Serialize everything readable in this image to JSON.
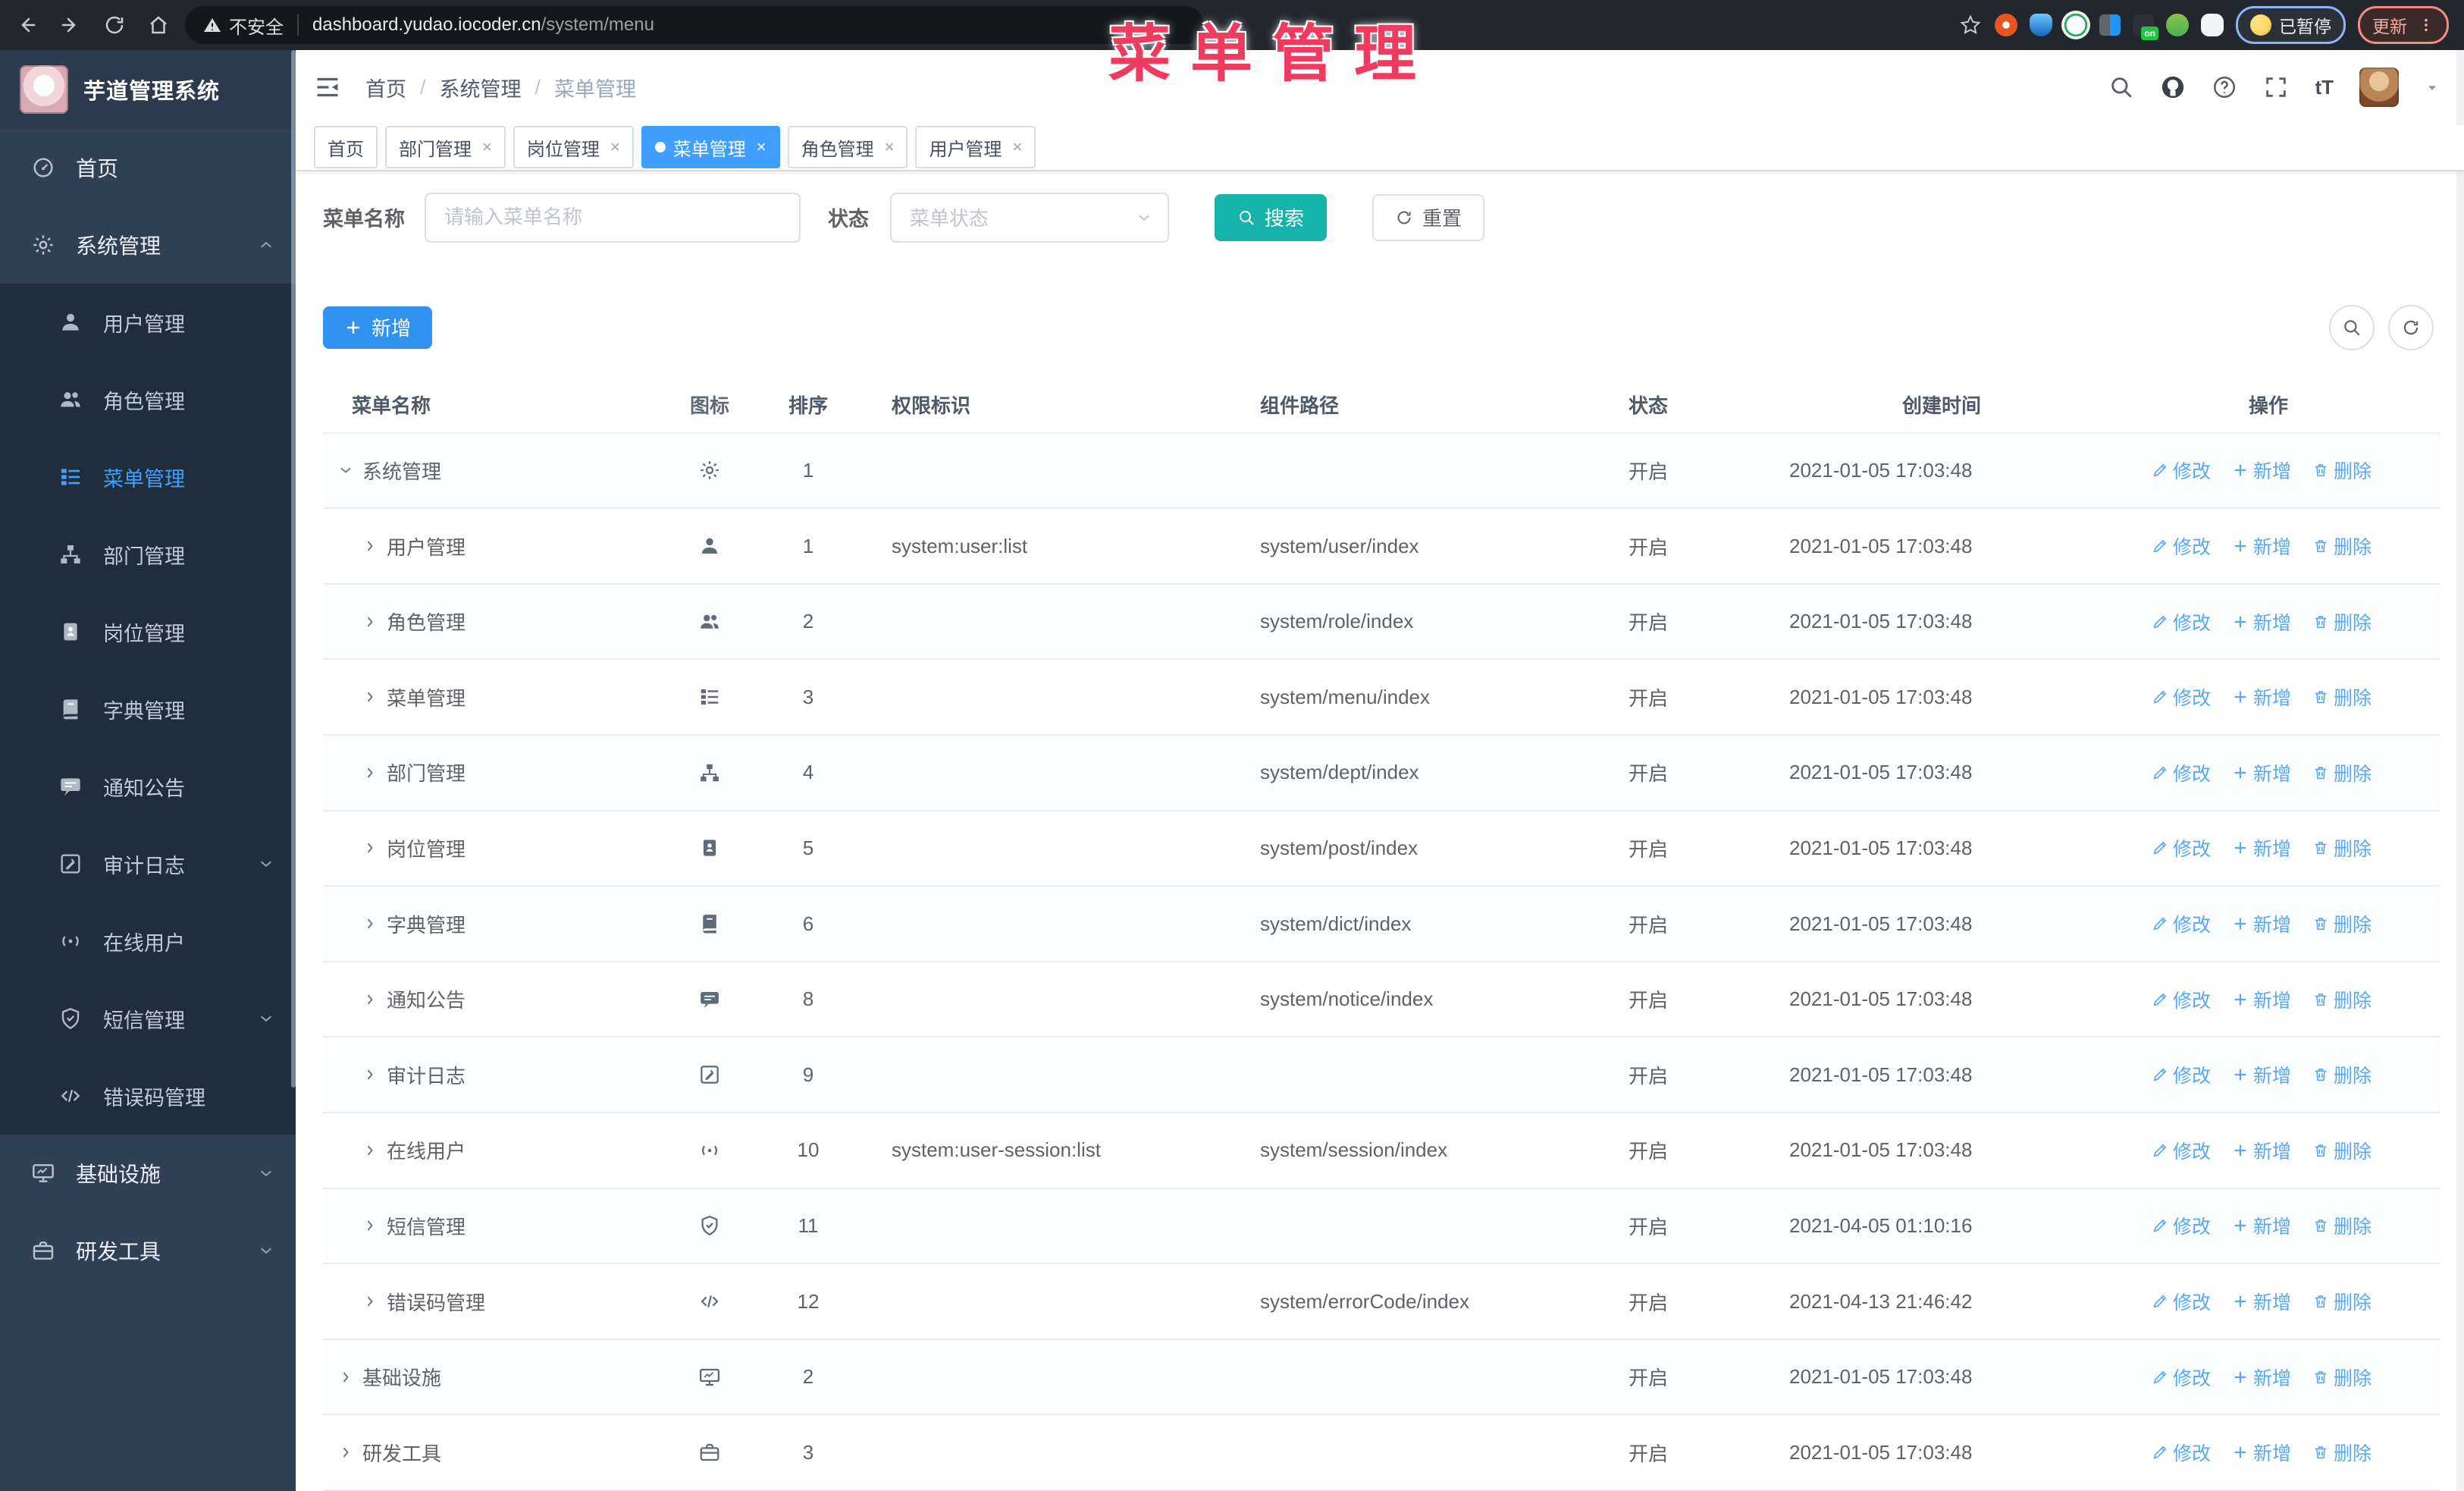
{
  "overlay_title": "菜单管理",
  "browser": {
    "security_label": "不安全",
    "url_host": "dashboard.yudao.iocoder.cn",
    "url_path": "/system/menu",
    "paused_label": "已暂停",
    "update_label": "更新"
  },
  "header": {
    "breadcrumb": [
      "首页",
      "系统管理",
      "菜单管理"
    ]
  },
  "tabs": [
    {
      "label": "首页",
      "closable": false,
      "active": false
    },
    {
      "label": "部门管理",
      "closable": true,
      "active": false
    },
    {
      "label": "岗位管理",
      "closable": true,
      "active": false
    },
    {
      "label": "菜单管理",
      "closable": true,
      "active": true
    },
    {
      "label": "角色管理",
      "closable": true,
      "active": false
    },
    {
      "label": "用户管理",
      "closable": true,
      "active": false
    }
  ],
  "sidebar": {
    "brand": "芋道管理系统",
    "items": [
      {
        "type": "root",
        "icon": "home",
        "label": "首页"
      },
      {
        "type": "root",
        "icon": "gear",
        "label": "系统管理",
        "chevron": "up",
        "open": true
      },
      {
        "type": "sub",
        "icon": "user",
        "label": "用户管理"
      },
      {
        "type": "sub",
        "icon": "users",
        "label": "角色管理"
      },
      {
        "type": "sub",
        "icon": "menu",
        "label": "菜单管理",
        "active": true
      },
      {
        "type": "sub",
        "icon": "org",
        "label": "部门管理"
      },
      {
        "type": "sub",
        "icon": "badge",
        "label": "岗位管理"
      },
      {
        "type": "sub",
        "icon": "dict",
        "label": "字典管理"
      },
      {
        "type": "sub",
        "icon": "notice",
        "label": "通知公告"
      },
      {
        "type": "sub",
        "icon": "log",
        "label": "审计日志",
        "chevron": "down"
      },
      {
        "type": "sub",
        "icon": "online",
        "label": "在线用户"
      },
      {
        "type": "sub",
        "icon": "sms",
        "label": "短信管理",
        "chevron": "down"
      },
      {
        "type": "sub",
        "icon": "code",
        "label": "错误码管理"
      },
      {
        "type": "root",
        "icon": "infra",
        "label": "基础设施",
        "chevron": "down"
      },
      {
        "type": "root",
        "icon": "tool",
        "label": "研发工具",
        "chevron": "down"
      }
    ]
  },
  "search": {
    "name_label": "菜单名称",
    "name_placeholder": "请输入菜单名称",
    "status_label": "状态",
    "status_placeholder": "菜单状态",
    "search_label": "搜索",
    "reset_label": "重置"
  },
  "toolbar": {
    "add_label": "新增"
  },
  "table": {
    "columns": [
      "菜单名称",
      "图标",
      "排序",
      "权限标识",
      "组件路径",
      "状态",
      "创建时间",
      "操作"
    ],
    "ops": {
      "edit": "修改",
      "add": "新增",
      "delete": "删除"
    },
    "rows": [
      {
        "name": "系统管理",
        "depth": 0,
        "expand": "down",
        "icon": "gear",
        "sort": "1",
        "perm": "",
        "path": "",
        "status": "开启",
        "time": "2021-01-05 17:03:48"
      },
      {
        "name": "用户管理",
        "depth": 1,
        "expand": "right",
        "icon": "user",
        "sort": "1",
        "perm": "system:user:list",
        "path": "system/user/index",
        "status": "开启",
        "time": "2021-01-05 17:03:48"
      },
      {
        "name": "角色管理",
        "depth": 1,
        "expand": "right",
        "icon": "users",
        "sort": "2",
        "perm": "",
        "path": "system/role/index",
        "status": "开启",
        "time": "2021-01-05 17:03:48"
      },
      {
        "name": "菜单管理",
        "depth": 1,
        "expand": "right",
        "icon": "menu",
        "sort": "3",
        "perm": "",
        "path": "system/menu/index",
        "status": "开启",
        "time": "2021-01-05 17:03:48"
      },
      {
        "name": "部门管理",
        "depth": 1,
        "expand": "right",
        "icon": "org",
        "sort": "4",
        "perm": "",
        "path": "system/dept/index",
        "status": "开启",
        "time": "2021-01-05 17:03:48"
      },
      {
        "name": "岗位管理",
        "depth": 1,
        "expand": "right",
        "icon": "badge",
        "sort": "5",
        "perm": "",
        "path": "system/post/index",
        "status": "开启",
        "time": "2021-01-05 17:03:48"
      },
      {
        "name": "字典管理",
        "depth": 1,
        "expand": "right",
        "icon": "dict",
        "sort": "6",
        "perm": "",
        "path": "system/dict/index",
        "status": "开启",
        "time": "2021-01-05 17:03:48"
      },
      {
        "name": "通知公告",
        "depth": 1,
        "expand": "right",
        "icon": "notice",
        "sort": "8",
        "perm": "",
        "path": "system/notice/index",
        "status": "开启",
        "time": "2021-01-05 17:03:48"
      },
      {
        "name": "审计日志",
        "depth": 1,
        "expand": "right",
        "icon": "log",
        "sort": "9",
        "perm": "",
        "path": "",
        "status": "开启",
        "time": "2021-01-05 17:03:48"
      },
      {
        "name": "在线用户",
        "depth": 1,
        "expand": "right",
        "icon": "online",
        "sort": "10",
        "perm": "system:user-session:list",
        "path": "system/session/index",
        "status": "开启",
        "time": "2021-01-05 17:03:48"
      },
      {
        "name": "短信管理",
        "depth": 1,
        "expand": "right",
        "icon": "sms",
        "sort": "11",
        "perm": "",
        "path": "",
        "status": "开启",
        "time": "2021-04-05 01:10:16"
      },
      {
        "name": "错误码管理",
        "depth": 1,
        "expand": "right",
        "icon": "code",
        "sort": "12",
        "perm": "",
        "path": "system/errorCode/index",
        "status": "开启",
        "time": "2021-04-13 21:46:42"
      },
      {
        "name": "基础设施",
        "depth": 0,
        "expand": "right",
        "icon": "infra",
        "sort": "2",
        "perm": "",
        "path": "",
        "status": "开启",
        "time": "2021-01-05 17:03:48"
      },
      {
        "name": "研发工具",
        "depth": 0,
        "expand": "right",
        "icon": "tool",
        "sort": "3",
        "perm": "",
        "path": "",
        "status": "开启",
        "time": "2021-01-05 17:03:48"
      }
    ]
  }
}
